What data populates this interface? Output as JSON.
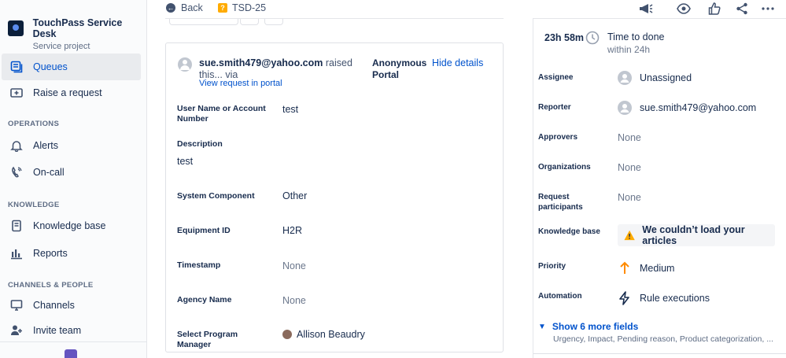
{
  "sidebar": {
    "project_name": "TouchPass Service Desk",
    "project_type": "Service project",
    "items": [
      {
        "label": "Queues",
        "icon": "queues-icon",
        "active": true
      },
      {
        "label": "Raise a request",
        "icon": "raise-request-icon"
      },
      {
        "label": "Alerts",
        "icon": "bell-icon"
      },
      {
        "label": "On-call",
        "icon": "on-call-icon"
      },
      {
        "label": "Knowledge base",
        "icon": "book-icon"
      },
      {
        "label": "Reports",
        "icon": "reports-icon"
      },
      {
        "label": "Channels",
        "icon": "monitor-icon"
      },
      {
        "label": "Invite team",
        "icon": "add-person-icon"
      }
    ],
    "sections": [
      "OPERATIONS",
      "KNOWLEDGE",
      "CHANNELS & PEOPLE"
    ]
  },
  "topbar": {
    "back_label": "Back",
    "ticket_key": "TSD-25"
  },
  "request": {
    "reporter_email": "sue.smith479@yahoo.com",
    "raised_text": "raised this... via",
    "channel": "Anonymous Portal",
    "hide_details": "Hide details",
    "view_portal": "View request in portal",
    "fields": [
      {
        "label": "User Name or Account Number",
        "value": "test"
      },
      {
        "label": "Description",
        "value": "test"
      },
      {
        "label": "System Component",
        "value": "Other"
      },
      {
        "label": "Equipment ID",
        "value": "H2R"
      },
      {
        "label": "Timestamp",
        "value": "None"
      },
      {
        "label": "Agency Name",
        "value": "None"
      },
      {
        "label": "Select Program Manager",
        "value": "Allison Beaudry"
      }
    ]
  },
  "sla": {
    "time": "23h 58m",
    "title": "Time to done",
    "subtitle": "within 24h"
  },
  "details": {
    "assignee_label": "Assignee",
    "assignee": "Unassigned",
    "reporter_label": "Reporter",
    "reporter": "sue.smith479@yahoo.com",
    "approvers_label": "Approvers",
    "approvers": "None",
    "organizations_label": "Organizations",
    "organizations": "None",
    "participants_label": "Request participants",
    "participants": "None",
    "kb_label": "Knowledge base",
    "kb_warning": "We couldn’t load your articles",
    "priority_label": "Priority",
    "priority": "Medium",
    "automation_label": "Automation",
    "automation": "Rule executions",
    "show_more": "Show 6 more fields",
    "more_fields": "Urgency, Impact, Pending reason, Product categorization, ..."
  },
  "colors": {
    "accent": "#0052cc",
    "warning": "#ffab00",
    "priority_medium": "#ff8b00"
  }
}
